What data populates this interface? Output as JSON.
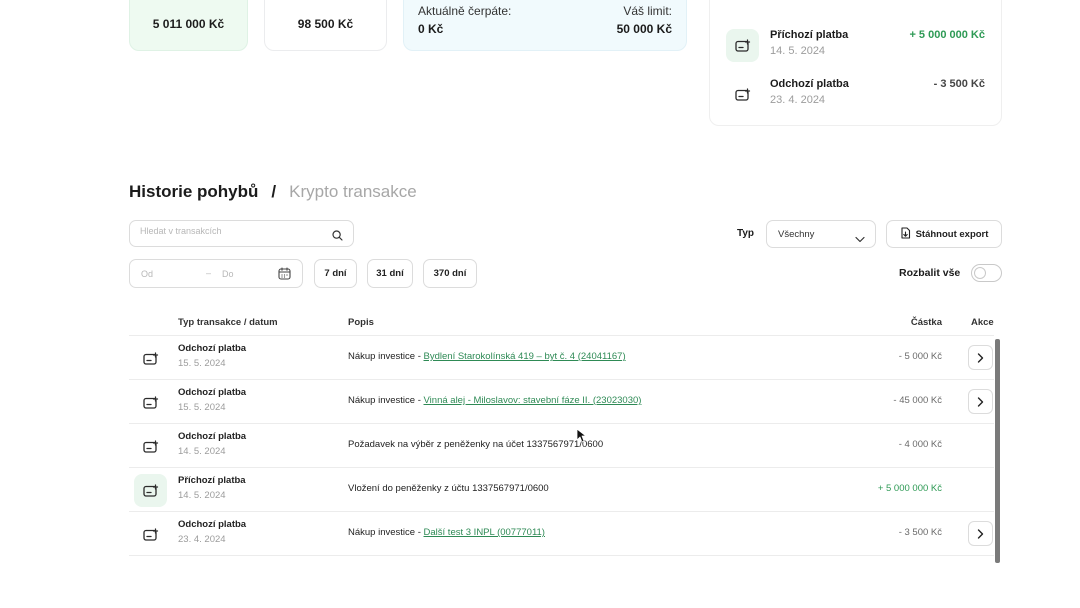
{
  "summary": {
    "balance_value": "5 011 000 Kč",
    "invested_value": "98 500 Kč",
    "limit": {
      "current_label": "Aktuálně čerpáte:",
      "current_value": "0 Kč",
      "limit_label": "Váš limit:",
      "limit_value": "50 000 Kč"
    }
  },
  "recent": [
    {
      "title": "Příchozí platba",
      "date": "14. 5. 2024",
      "amount": "+ 5 000 000 Kč",
      "direction": "income"
    },
    {
      "title": "Odchozí platba",
      "date": "23. 4. 2024",
      "amount": "- 3 500 Kč",
      "direction": "outgoing"
    }
  ],
  "history": {
    "tab_active": "Historie pohybů",
    "separator": "/",
    "tab_inactive": "Krypto transakce"
  },
  "filters": {
    "search_placeholder": "Hledat v transakcích",
    "type_label": "Typ",
    "type_value": "Všechny",
    "export_label": "Stáhnout export",
    "date_from_placeholder": "Od",
    "date_separator": "–",
    "date_to_placeholder": "Do",
    "chips": [
      "7 dní",
      "31 dní",
      "370 dní"
    ],
    "expand_label": "Rozbalit vše",
    "expand_on": false
  },
  "table": {
    "headers": {
      "type": "Typ transakce / datum",
      "description": "Popis",
      "amount": "Částka",
      "action": "Akce"
    },
    "rows": [
      {
        "type": "Odchozí platba",
        "date": "15. 5. 2024",
        "desc_text": "Nákup investice - ",
        "desc_link": "Bydlení Starokolínská 419 – byt č. 4 (24041167)",
        "amount": "- 5 000 Kč",
        "direction": "outgoing",
        "has_action": true
      },
      {
        "type": "Odchozí platba",
        "date": "15. 5. 2024",
        "desc_text": "Nákup investice - ",
        "desc_link": "Vinná alej - Miloslavov: stavební fáze II. (23023030)",
        "amount": "- 45 000 Kč",
        "direction": "outgoing",
        "has_action": true
      },
      {
        "type": "Odchozí platba",
        "date": "14. 5. 2024",
        "desc_text": "Požadavek na výběr z peněženky na účet 1337567971/0600",
        "desc_link": "",
        "amount": "- 4 000 Kč",
        "direction": "outgoing",
        "has_action": false
      },
      {
        "type": "Příchozí platba",
        "date": "14. 5. 2024",
        "desc_text": "Vložení do peněženky z účtu 1337567971/0600",
        "desc_link": "",
        "amount": "+ 5 000 000 Kč",
        "direction": "income",
        "has_action": false
      },
      {
        "type": "Odchozí platba",
        "date": "23. 4. 2024",
        "desc_text": "Nákup investice - ",
        "desc_link": "Další test 3 INPL (00777011)",
        "amount": "- 3 500 Kč",
        "direction": "outgoing",
        "has_action": true
      }
    ]
  },
  "colors": {
    "positive": "#2e9a55",
    "link": "#2e8a55",
    "income_icon_bg": "#eaf6ee"
  }
}
